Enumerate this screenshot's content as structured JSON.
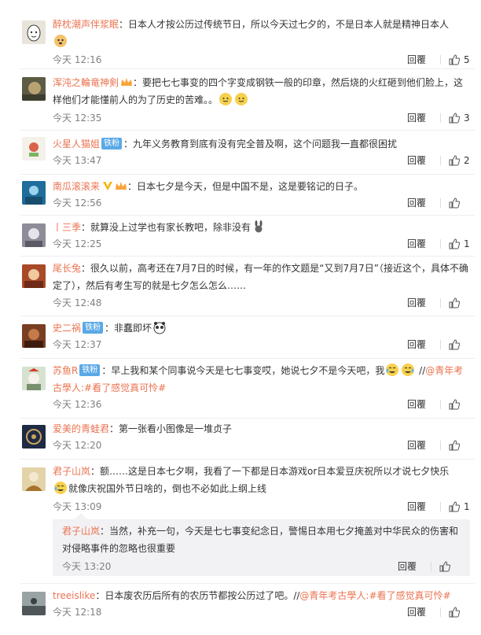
{
  "comments": [
    {
      "user": "醉枕潮声伴浆眠",
      "text": "：日本人才按公历过传统节日，所以今天过七夕的，不是日本人就是精神日本人",
      "time": "今天 12:16",
      "reply_label": "回覆",
      "likes": "5",
      "avatar_color": "#e8e4da",
      "crown": false,
      "vip": false,
      "badge": ""
    },
    {
      "user": "浑沌之輪竜神剣",
      "text": "：要把七七事变的四个字变成钢铁一般的印章，然后烧的火红砸到他们脸上，这样他们才能懂前人的为了历史的苦难。。",
      "time": "今天 12:35",
      "reply_label": "回覆",
      "likes": "3",
      "avatar_color": "#6b6a54",
      "crown": true,
      "vip": false,
      "badge": ""
    },
    {
      "user": "火星人猫姐",
      "text": "：九年义务教育到底有没有完全普及啊，这个问题我一直都很困扰",
      "time": "今天 13:47",
      "reply_label": "回覆",
      "likes": "2",
      "avatar_color": "#f2efe8",
      "crown": false,
      "vip": false,
      "badge": "铁粉"
    },
    {
      "user": "南瓜滚滚来",
      "text": "：日本七夕是今天，但是中国不是，这是要铭记的日子。",
      "time": "今天 12:56",
      "reply_label": "回覆",
      "likes": "",
      "avatar_color": "#2e7ea8",
      "crown": true,
      "vip": true,
      "badge": ""
    },
    {
      "user": "丨三季",
      "text": "：就算没上过学也有家长教吧，除非没有",
      "time": "今天 12:25",
      "reply_label": "回覆",
      "likes": "1",
      "avatar_color": "#9a98a3",
      "crown": false,
      "vip": false,
      "badge": ""
    },
    {
      "user": "尾长兔",
      "text": "：很久以前，高考还在7月7日的时候，有一年的作文题是“又到7月7日”（接近这个，具体不确定了），然后有考生写的就是七夕怎么怎么……",
      "time": "今天 12:48",
      "reply_label": "回覆",
      "likes": "",
      "avatar_color": "#b0502a",
      "crown": false,
      "vip": false,
      "badge": ""
    },
    {
      "user": "史二祸",
      "text": "：非蠢即坏",
      "time": "今天 12:37",
      "reply_label": "回覆",
      "likes": "",
      "avatar_color": "#8a4e2e",
      "crown": false,
      "vip": false,
      "badge": "铁粉"
    },
    {
      "user": "苏鱼R",
      "text": "：早上我和某个同事说今天是七七事变哎，她说七夕不是今天吧，我",
      "text_tail": " //",
      "mention": "@青年考古學人",
      "topic": ":#看了感觉真可怜#",
      "time": "今天 12:36",
      "reply_label": "回覆",
      "likes": "",
      "avatar_color": "#c9d6c2",
      "crown": false,
      "vip": false,
      "badge": "铁粉"
    },
    {
      "user": "爱美的青蛙君",
      "text": "：第一张看小图像是一堆贞子",
      "time": "今天 12:20",
      "reply_label": "回覆",
      "likes": "",
      "avatar_color": "#2a3552",
      "crown": false,
      "vip": false,
      "badge": ""
    },
    {
      "user": "君子山岚",
      "text": "：额……这是日本七夕啊，我看了一下都是日本游戏or日本爱豆庆祝所以才说七夕快乐",
      "text2": "就像庆祝国外节日啥的，倒也不必如此上纲上线",
      "time": "今天 13:09",
      "reply_label": "回覆",
      "likes": "1",
      "avatar_color": "#d8c9a0",
      "crown": false,
      "vip": false,
      "badge": "",
      "nested": {
        "user": "君子山岚",
        "text": "：当然，补充一句，今天是七七事变纪念日，警惕日本用七夕掩盖对中华民众的伤害和对侵略事件的忽略也很重要",
        "time": "今天 13:20",
        "reply_label": "回覆",
        "likes": ""
      }
    },
    {
      "user": "treeislike",
      "text": "：日本废农历后所有的农历节都按公历过了吧。//",
      "mention": "@青年考古學人",
      "topic": ":#看了感觉真可怜#",
      "time": "今天 12:18",
      "reply_label": "回覆",
      "likes": "",
      "avatar_color": "#7f8a8c",
      "crown": false,
      "vip": false,
      "badge": ""
    }
  ],
  "colors": {
    "username": "#eb7350",
    "badge": "#5aa9e6",
    "time": "#808080",
    "nested_bg": "#f2f2f5"
  }
}
